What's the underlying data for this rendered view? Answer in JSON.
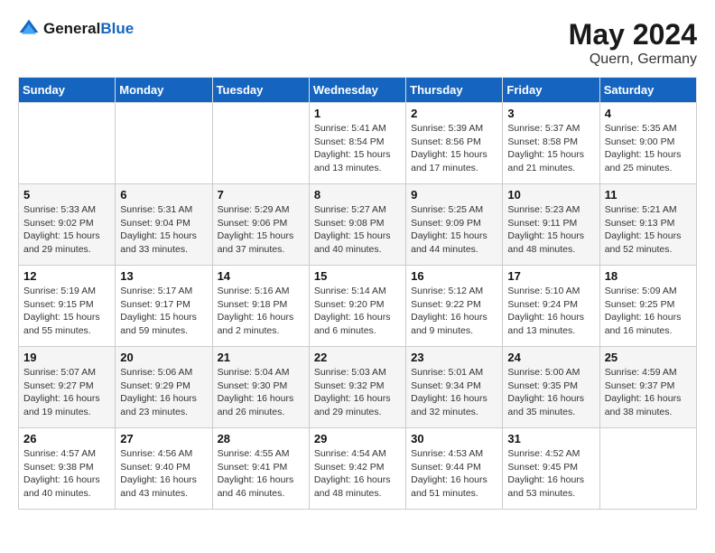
{
  "header": {
    "logo_line1": "General",
    "logo_line2": "Blue",
    "month": "May 2024",
    "location": "Quern, Germany"
  },
  "weekdays": [
    "Sunday",
    "Monday",
    "Tuesday",
    "Wednesday",
    "Thursday",
    "Friday",
    "Saturday"
  ],
  "weeks": [
    [
      {
        "day": "",
        "info": ""
      },
      {
        "day": "",
        "info": ""
      },
      {
        "day": "",
        "info": ""
      },
      {
        "day": "1",
        "info": "Sunrise: 5:41 AM\nSunset: 8:54 PM\nDaylight: 15 hours\nand 13 minutes."
      },
      {
        "day": "2",
        "info": "Sunrise: 5:39 AM\nSunset: 8:56 PM\nDaylight: 15 hours\nand 17 minutes."
      },
      {
        "day": "3",
        "info": "Sunrise: 5:37 AM\nSunset: 8:58 PM\nDaylight: 15 hours\nand 21 minutes."
      },
      {
        "day": "4",
        "info": "Sunrise: 5:35 AM\nSunset: 9:00 PM\nDaylight: 15 hours\nand 25 minutes."
      }
    ],
    [
      {
        "day": "5",
        "info": "Sunrise: 5:33 AM\nSunset: 9:02 PM\nDaylight: 15 hours\nand 29 minutes."
      },
      {
        "day": "6",
        "info": "Sunrise: 5:31 AM\nSunset: 9:04 PM\nDaylight: 15 hours\nand 33 minutes."
      },
      {
        "day": "7",
        "info": "Sunrise: 5:29 AM\nSunset: 9:06 PM\nDaylight: 15 hours\nand 37 minutes."
      },
      {
        "day": "8",
        "info": "Sunrise: 5:27 AM\nSunset: 9:08 PM\nDaylight: 15 hours\nand 40 minutes."
      },
      {
        "day": "9",
        "info": "Sunrise: 5:25 AM\nSunset: 9:09 PM\nDaylight: 15 hours\nand 44 minutes."
      },
      {
        "day": "10",
        "info": "Sunrise: 5:23 AM\nSunset: 9:11 PM\nDaylight: 15 hours\nand 48 minutes."
      },
      {
        "day": "11",
        "info": "Sunrise: 5:21 AM\nSunset: 9:13 PM\nDaylight: 15 hours\nand 52 minutes."
      }
    ],
    [
      {
        "day": "12",
        "info": "Sunrise: 5:19 AM\nSunset: 9:15 PM\nDaylight: 15 hours\nand 55 minutes."
      },
      {
        "day": "13",
        "info": "Sunrise: 5:17 AM\nSunset: 9:17 PM\nDaylight: 15 hours\nand 59 minutes."
      },
      {
        "day": "14",
        "info": "Sunrise: 5:16 AM\nSunset: 9:18 PM\nDaylight: 16 hours\nand 2 minutes."
      },
      {
        "day": "15",
        "info": "Sunrise: 5:14 AM\nSunset: 9:20 PM\nDaylight: 16 hours\nand 6 minutes."
      },
      {
        "day": "16",
        "info": "Sunrise: 5:12 AM\nSunset: 9:22 PM\nDaylight: 16 hours\nand 9 minutes."
      },
      {
        "day": "17",
        "info": "Sunrise: 5:10 AM\nSunset: 9:24 PM\nDaylight: 16 hours\nand 13 minutes."
      },
      {
        "day": "18",
        "info": "Sunrise: 5:09 AM\nSunset: 9:25 PM\nDaylight: 16 hours\nand 16 minutes."
      }
    ],
    [
      {
        "day": "19",
        "info": "Sunrise: 5:07 AM\nSunset: 9:27 PM\nDaylight: 16 hours\nand 19 minutes."
      },
      {
        "day": "20",
        "info": "Sunrise: 5:06 AM\nSunset: 9:29 PM\nDaylight: 16 hours\nand 23 minutes."
      },
      {
        "day": "21",
        "info": "Sunrise: 5:04 AM\nSunset: 9:30 PM\nDaylight: 16 hours\nand 26 minutes."
      },
      {
        "day": "22",
        "info": "Sunrise: 5:03 AM\nSunset: 9:32 PM\nDaylight: 16 hours\nand 29 minutes."
      },
      {
        "day": "23",
        "info": "Sunrise: 5:01 AM\nSunset: 9:34 PM\nDaylight: 16 hours\nand 32 minutes."
      },
      {
        "day": "24",
        "info": "Sunrise: 5:00 AM\nSunset: 9:35 PM\nDaylight: 16 hours\nand 35 minutes."
      },
      {
        "day": "25",
        "info": "Sunrise: 4:59 AM\nSunset: 9:37 PM\nDaylight: 16 hours\nand 38 minutes."
      }
    ],
    [
      {
        "day": "26",
        "info": "Sunrise: 4:57 AM\nSunset: 9:38 PM\nDaylight: 16 hours\nand 40 minutes."
      },
      {
        "day": "27",
        "info": "Sunrise: 4:56 AM\nSunset: 9:40 PM\nDaylight: 16 hours\nand 43 minutes."
      },
      {
        "day": "28",
        "info": "Sunrise: 4:55 AM\nSunset: 9:41 PM\nDaylight: 16 hours\nand 46 minutes."
      },
      {
        "day": "29",
        "info": "Sunrise: 4:54 AM\nSunset: 9:42 PM\nDaylight: 16 hours\nand 48 minutes."
      },
      {
        "day": "30",
        "info": "Sunrise: 4:53 AM\nSunset: 9:44 PM\nDaylight: 16 hours\nand 51 minutes."
      },
      {
        "day": "31",
        "info": "Sunrise: 4:52 AM\nSunset: 9:45 PM\nDaylight: 16 hours\nand 53 minutes."
      },
      {
        "day": "",
        "info": ""
      }
    ]
  ]
}
